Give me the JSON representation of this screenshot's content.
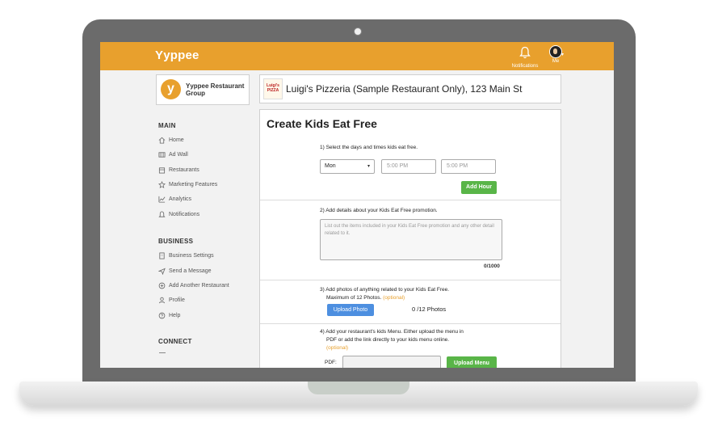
{
  "app": {
    "brand": "Yyppee"
  },
  "topbar": {
    "notifications_label": "Notifications",
    "me_label": "Me"
  },
  "org": {
    "logo_letter": "y",
    "name": "Yyppee Restaurant Group"
  },
  "sidebar": {
    "main_title": "MAIN",
    "main_items": [
      {
        "label": "Home",
        "icon": "home-icon"
      },
      {
        "label": "Ad Wall",
        "icon": "ad-wall-icon"
      },
      {
        "label": "Restaurants",
        "icon": "restaurants-icon"
      },
      {
        "label": "Marketing Features",
        "icon": "star-icon"
      },
      {
        "label": "Analytics",
        "icon": "analytics-icon"
      },
      {
        "label": "Notifications",
        "icon": "bell-icon"
      }
    ],
    "business_title": "BUSINESS",
    "business_items": [
      {
        "label": "Business Settings",
        "icon": "building-icon"
      },
      {
        "label": "Send a Message",
        "icon": "send-icon"
      },
      {
        "label": "Add Another Restaurant",
        "icon": "plus-circle-icon"
      },
      {
        "label": "Profile",
        "icon": "user-icon"
      },
      {
        "label": "Help",
        "icon": "help-icon"
      }
    ],
    "connect_title": "CONNECT"
  },
  "restaurant": {
    "logo_text": "Luigi's PIZZA",
    "title": "Luigi's Pizzeria (Sample Restaurant Only), 123 Main St"
  },
  "form": {
    "title": "Create Kids Eat Free",
    "step1": "1) Select the days and times kids eat free.",
    "day_value": "Mon",
    "start_time_placeholder": "5:00 PM",
    "end_time_placeholder": "5:00 PM",
    "add_hour_label": "Add Hour",
    "step2": "2) Add details about your Kids Eat Free promotion.",
    "details_placeholder": "List out the items included in your Kids Eat Free promotion and any other detail related to it.",
    "char_counter": "0/1000",
    "step3_line1": "3) Add photos of anything related to your Kids Eat Free.",
    "step3_line2": "Maximum of 12 Photos.",
    "optional": "(optional)",
    "upload_photo_label": "Upload Photo",
    "photos_count": "0 /12 Photos",
    "step4_line1": "4) Add your restaurant's kids Menu. Either upload the menu in",
    "step4_line2": "PDF or add the link directly to your kids menu online.",
    "pdf_label": "PDF:",
    "upload_menu_label": "Upload Menu"
  },
  "colors": {
    "brand_orange": "#e8a02d",
    "green": "#59b548",
    "blue": "#4d8fe0"
  }
}
